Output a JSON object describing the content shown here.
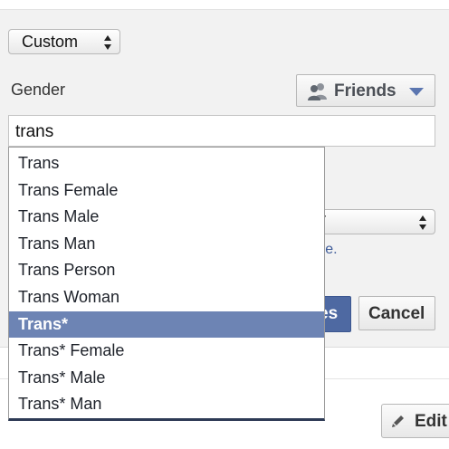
{
  "form": {
    "privacy_select_value": "Custom",
    "gender_label": "Gender",
    "audience_button_label": "Friends",
    "gender_input_value": "trans",
    "hidden_select_partial": "r",
    "learn_more_partial": "ore.",
    "save_label_partial": "es",
    "cancel_label": "Cancel"
  },
  "dropdown": {
    "options": [
      "Trans",
      "Trans Female",
      "Trans Male",
      "Trans Man",
      "Trans Person",
      "Trans Woman",
      "Trans*",
      "Trans* Female",
      "Trans* Male",
      "Trans* Man"
    ],
    "selected_index": 6
  },
  "footer": {
    "edit_label_partial": "Edit"
  },
  "icons": {
    "select_arrows": "up-down-arrows-icon",
    "audience": "people-icon",
    "caret": "caret-down-icon",
    "edit": "pencil-icon"
  },
  "colors": {
    "accent": "#6d84b4",
    "link": "#3b5998",
    "primary_button": "#4e69a2"
  }
}
